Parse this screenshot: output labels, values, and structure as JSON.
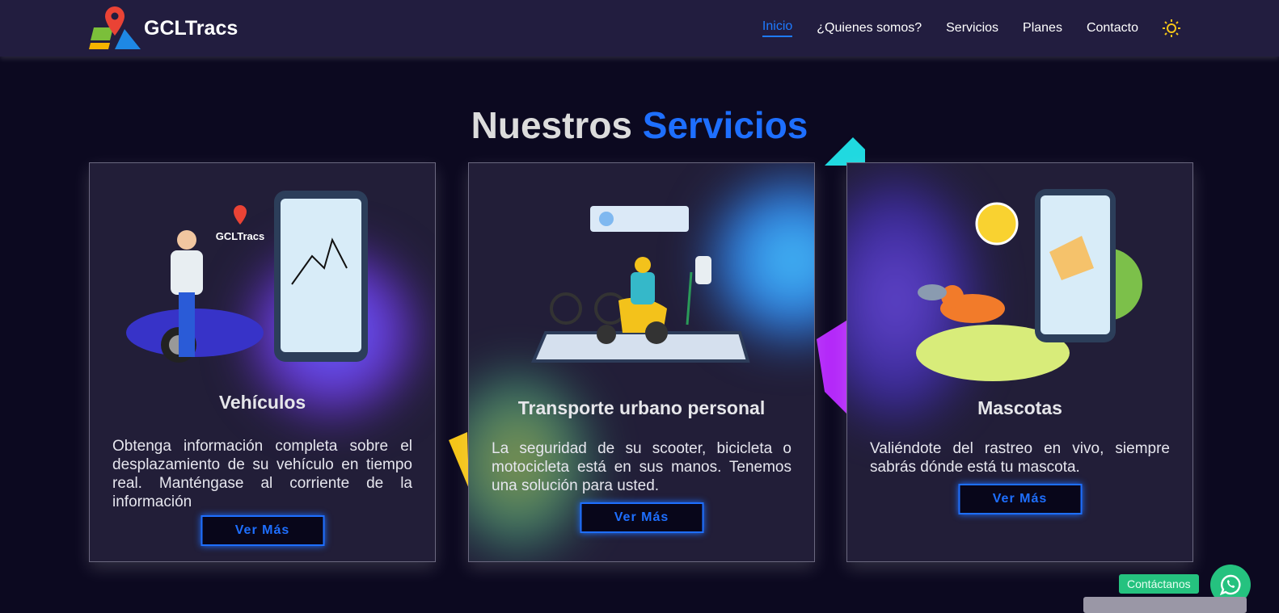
{
  "nav": {
    "brand": "GCLTracs",
    "items": [
      {
        "label": "Inicio",
        "active": true
      },
      {
        "label": "¿Quienes somos?"
      },
      {
        "label": "Servicios"
      },
      {
        "label": "Planes"
      },
      {
        "label": "Contacto"
      }
    ],
    "theme_icon": "sun-icon"
  },
  "section": {
    "title_a": "Nuestros",
    "title_b": "Servicios"
  },
  "cards": [
    {
      "title": "Vehículos",
      "text": "Obtenga información completa sobre el desplazamiento de su vehículo en tiempo real. Manténgase al corriente de la información",
      "button": "Ver Más"
    },
    {
      "title": "Transporte urbano personal",
      "text": "La seguridad de su scooter, bicicleta o motocicleta está en sus manos. Tenemos una solución para usted.",
      "button": "Ver Más"
    },
    {
      "title": "Mascotas",
      "text": "Valiéndote del rastreo en vivo, siempre sabrás dónde está tu mascota.",
      "button": "Ver Más"
    }
  ],
  "contact": {
    "label": "Contáctanos",
    "icon": "whatsapp-icon"
  },
  "colors": {
    "accent": "#1e6fff",
    "whatsapp": "#25c27f",
    "background": "#0c0920",
    "nav": "#221d3f"
  }
}
